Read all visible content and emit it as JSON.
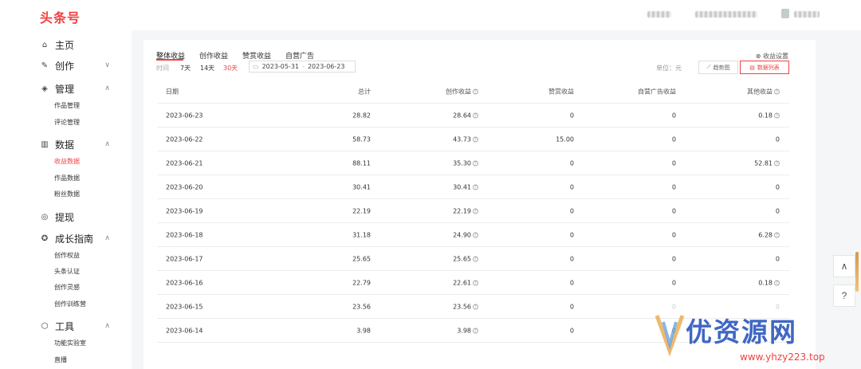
{
  "header": {
    "logo": "头条号"
  },
  "sidebar": {
    "groups": [
      {
        "label": "主页"
      },
      {
        "label": "创作"
      },
      {
        "label": "管理",
        "items": [
          "作品管理",
          "评论管理"
        ]
      },
      {
        "label": "数据",
        "items": [
          "收益数据",
          "作品数据",
          "粉丝数据"
        ]
      },
      {
        "label": "提现"
      },
      {
        "label": "成长指南",
        "items": [
          "创作权益",
          "头条认证",
          "创作灵感",
          "创作训练营"
        ]
      },
      {
        "label": "工具",
        "items": [
          "功能实验室",
          "直播"
        ]
      }
    ]
  },
  "tabs": [
    "整体收益",
    "创作收益",
    "赞赏收益",
    "自营广告"
  ],
  "settings_label": "收益设置",
  "time_label": "时间",
  "ranges": [
    "7天",
    "14天",
    "30天"
  ],
  "date_range": {
    "start": "2023-05-31",
    "end": "2023-06-23"
  },
  "unit_label": "单位：元",
  "view_buttons": [
    "趋势图",
    "数据列表"
  ],
  "table": {
    "headers": [
      "日期",
      "总计",
      "创作收益",
      "赞赏收益",
      "自营广告收益",
      "其他收益"
    ],
    "rows": [
      [
        "2023-06-23",
        "28.82",
        "28.64",
        "0",
        "0",
        "0.18"
      ],
      [
        "2023-06-22",
        "58.73",
        "43.73",
        "15.00",
        "0",
        "0"
      ],
      [
        "2023-06-21",
        "88.11",
        "35.30",
        "0",
        "0",
        "52.81"
      ],
      [
        "2023-06-20",
        "30.41",
        "30.41",
        "0",
        "0",
        "0"
      ],
      [
        "2023-06-19",
        "22.19",
        "22.19",
        "0",
        "0",
        "0"
      ],
      [
        "2023-06-18",
        "31.18",
        "24.90",
        "0",
        "0",
        "6.28"
      ],
      [
        "2023-06-17",
        "25.65",
        "25.65",
        "0",
        "0",
        "0"
      ],
      [
        "2023-06-16",
        "22.79",
        "22.61",
        "0",
        "0",
        "0.18"
      ],
      [
        "2023-06-15",
        "23.56",
        "23.56",
        "0",
        "0",
        "0"
      ],
      [
        "2023-06-14",
        "3.98",
        "3.98",
        "0",
        "0",
        "0"
      ]
    ]
  },
  "watermark": {
    "text": "优资源网",
    "url": "www.yhzy223.top"
  },
  "colors": {
    "accent": "#f04142",
    "watermark_blue": "#3f67c4"
  }
}
